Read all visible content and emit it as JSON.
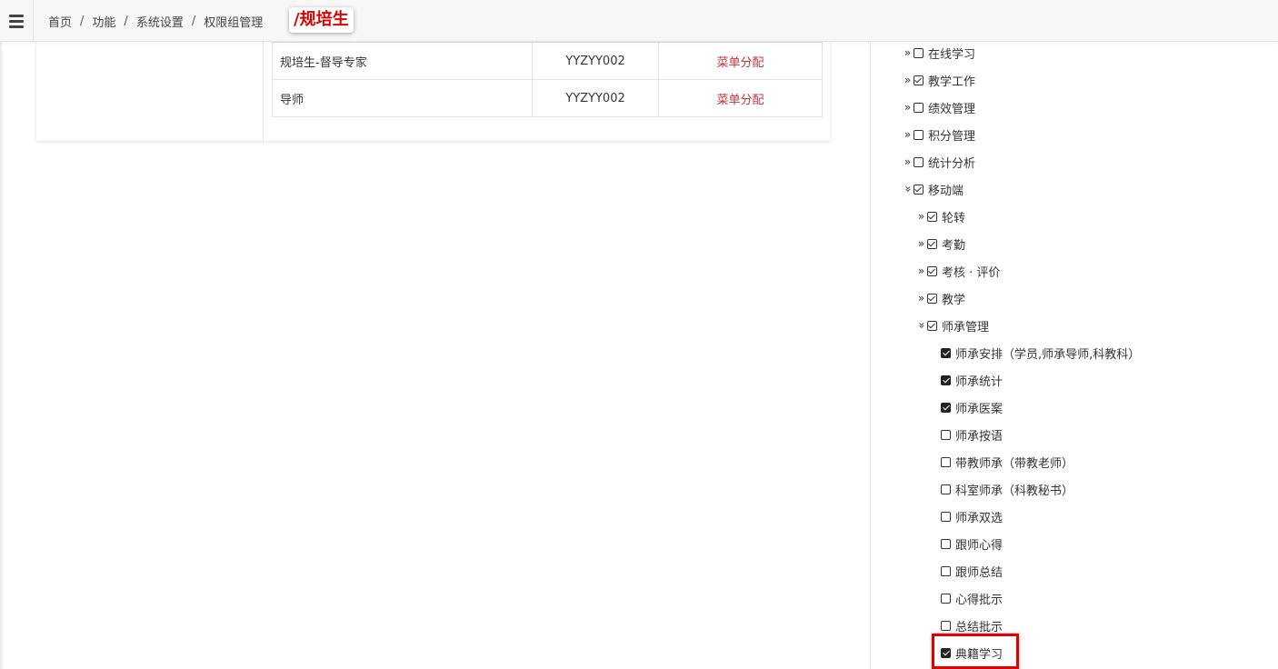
{
  "breadcrumb": {
    "items": [
      "首页",
      "功能",
      "系统设置",
      "权限组管理"
    ],
    "separator": "/"
  },
  "annotation": "/规培生",
  "roles_table": {
    "rows": [
      {
        "name": "规培生-督导专家",
        "code": "YYZYY002",
        "action": "菜单分配"
      },
      {
        "name": "导师",
        "code": "YYZYY002",
        "action": "菜单分配"
      }
    ]
  },
  "tree": {
    "n0": {
      "label": "在线学习",
      "state": "unchecked",
      "arrow": "»"
    },
    "n1": {
      "label": "教学工作",
      "state": "checked",
      "arrow": "»"
    },
    "n2": {
      "label": "绩效管理",
      "state": "unchecked",
      "arrow": "»"
    },
    "n3": {
      "label": "积分管理",
      "state": "unchecked",
      "arrow": "»"
    },
    "n4": {
      "label": "统计分析",
      "state": "unchecked",
      "arrow": "»"
    },
    "n5": {
      "label": "移动端",
      "state": "checked",
      "arrow": "«"
    },
    "n6": {
      "label": "轮转",
      "state": "checked",
      "arrow": "»"
    },
    "n7": {
      "label": "考勤",
      "state": "checked",
      "arrow": "»"
    },
    "n8": {
      "label": "考核 · 评价",
      "state": "checked",
      "arrow": "»"
    },
    "n9": {
      "label": "教学",
      "state": "checked",
      "arrow": "»"
    },
    "n10": {
      "label": "师承管理",
      "state": "checked",
      "arrow": "«"
    },
    "n11": {
      "label": "师承安排（学员,师承导师,科教科）",
      "state": "filled"
    },
    "n12": {
      "label": "师承统计",
      "state": "filled"
    },
    "n13": {
      "label": "师承医案",
      "state": "filled"
    },
    "n14": {
      "label": "师承按语",
      "state": "unchecked"
    },
    "n15": {
      "label": "带教师承（带教老师）",
      "state": "unchecked"
    },
    "n16": {
      "label": "科室师承（科教秘书）",
      "state": "unchecked"
    },
    "n17": {
      "label": "师承双选",
      "state": "unchecked"
    },
    "n18": {
      "label": "跟师心得",
      "state": "unchecked"
    },
    "n19": {
      "label": "跟师总结",
      "state": "unchecked"
    },
    "n20": {
      "label": "心得批示",
      "state": "unchecked"
    },
    "n21": {
      "label": "总结批示",
      "state": "unchecked"
    },
    "n22": {
      "label": "典籍学习",
      "state": "filled"
    }
  },
  "colors": {
    "action_link": "#c2343f",
    "annotation_red": "#e00000"
  }
}
